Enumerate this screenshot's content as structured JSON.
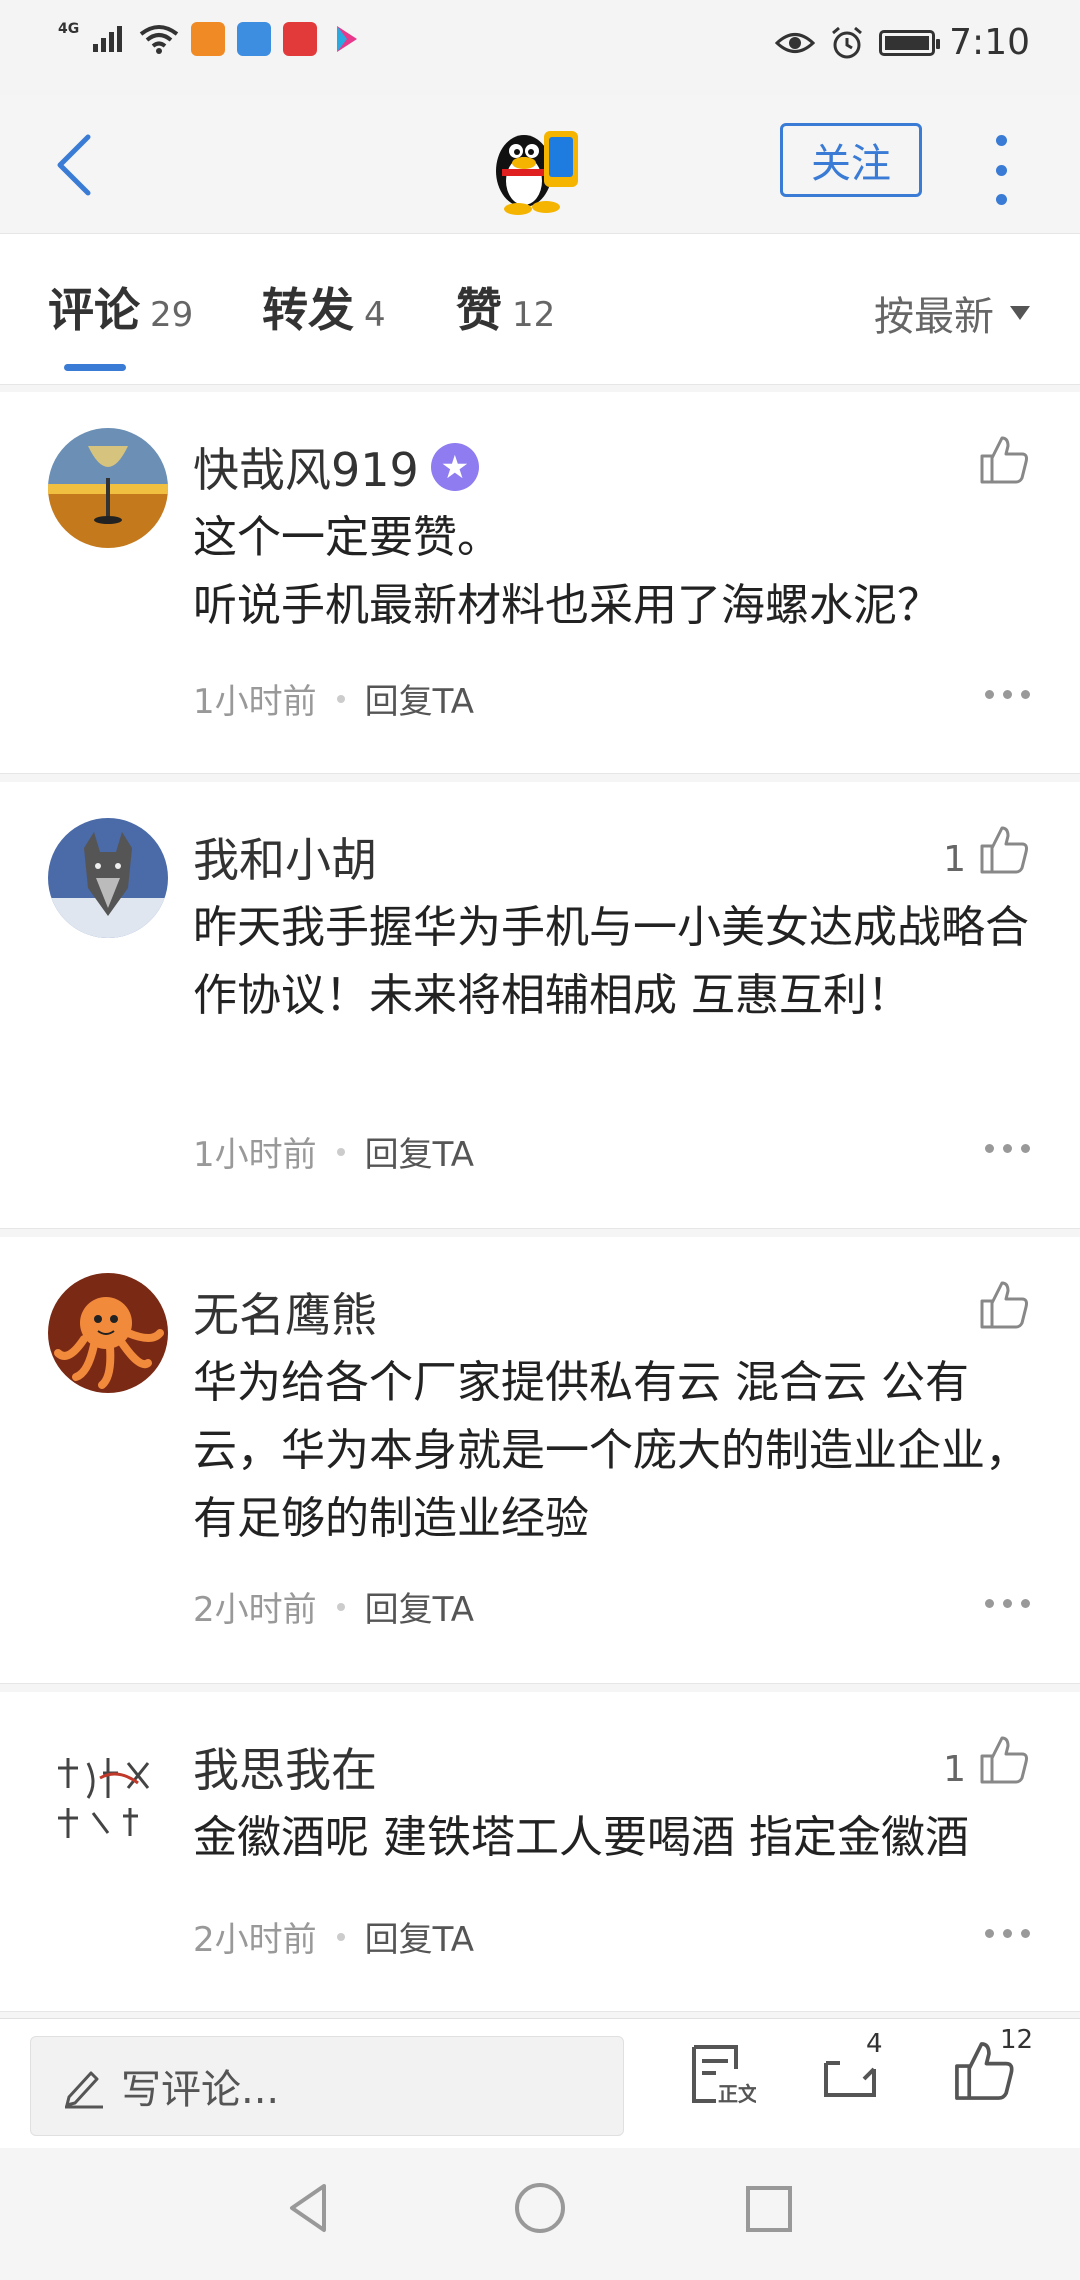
{
  "status_bar": {
    "network": "4G",
    "time": "7:10"
  },
  "header": {
    "follow_label": "关注"
  },
  "tabs": [
    {
      "label": "评论",
      "count": "29"
    },
    {
      "label": "转发",
      "count": "4"
    },
    {
      "label": "赞",
      "count": "12"
    }
  ],
  "sort_label": "按最新",
  "comments": [
    {
      "name": "快哉风919",
      "text": "这个一定要赞。\n听说手机最新材料也采用了海螺水泥？",
      "time": "1小时前",
      "reply": "回复TA",
      "likes": ""
    },
    {
      "name": "我和小胡",
      "text": "昨天我手握华为手机与一小美女达成战略合作协议！未来将相辅相成 互惠互利！",
      "time": "1小时前",
      "reply": "回复TA",
      "likes": "1"
    },
    {
      "name": "无名鹰熊",
      "text": "华为给各个厂家提供私有云 混合云 公有云，华为本身就是一个庞大的制造业企业，有足够的制造业经验",
      "time": "2小时前",
      "reply": "回复TA",
      "likes": ""
    },
    {
      "name": "我思我在",
      "text": "金徽酒呢 建铁塔工人要喝酒 指定金徽酒",
      "time": "2小时前",
      "reply": "回复TA",
      "likes": "1"
    }
  ],
  "bottom_bar": {
    "write_placeholder": "写评论...",
    "repost_count": "4",
    "like_count": "12"
  },
  "colors": {
    "accent": "#3a7bd5",
    "vip": "#8e7cf0"
  }
}
